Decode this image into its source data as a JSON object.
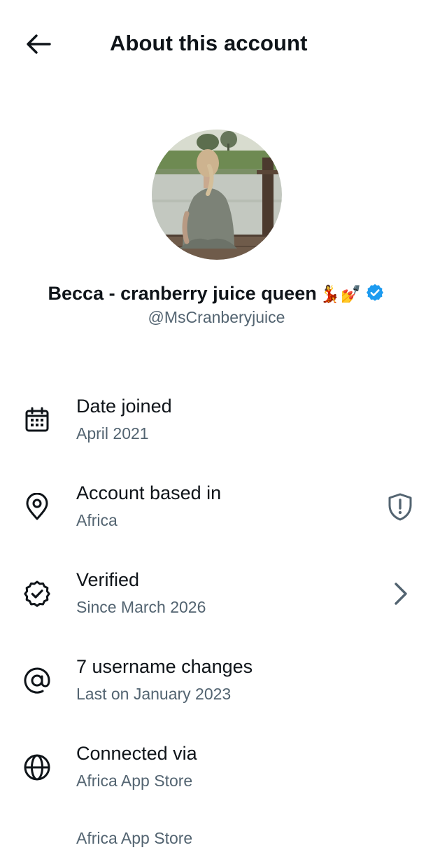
{
  "header": {
    "title": "About this account",
    "back_icon": "arrow-left-icon"
  },
  "profile": {
    "display_name": "Becca - cranberry juice queen",
    "name_emojis": "💃💅",
    "handle": "@MsCranberyjuice",
    "verified": true,
    "verified_color": "#1d9bf0"
  },
  "info": {
    "date_joined": {
      "icon": "calendar-icon",
      "label": "Date joined",
      "value": "April 2021"
    },
    "account_based_in": {
      "icon": "location-pin-icon",
      "label": "Account based in",
      "value": "Africa",
      "trailing_icon": "shield-alert-icon"
    },
    "verified": {
      "icon": "verified-badge-icon",
      "label": "Verified",
      "value": "Since March 2026",
      "trailing_icon": "chevron-right-icon"
    },
    "username_changes": {
      "icon": "at-sign-icon",
      "label": "7 username changes",
      "value": "Last on January 2023"
    },
    "connected_via": {
      "icon": "globe-icon",
      "label": "Connected via",
      "value": "Africa App Store"
    }
  },
  "cutoff_text": "Africa App Store",
  "colors": {
    "text_primary": "#0f1419",
    "text_secondary": "#536471",
    "accent": "#1d9bf0"
  }
}
